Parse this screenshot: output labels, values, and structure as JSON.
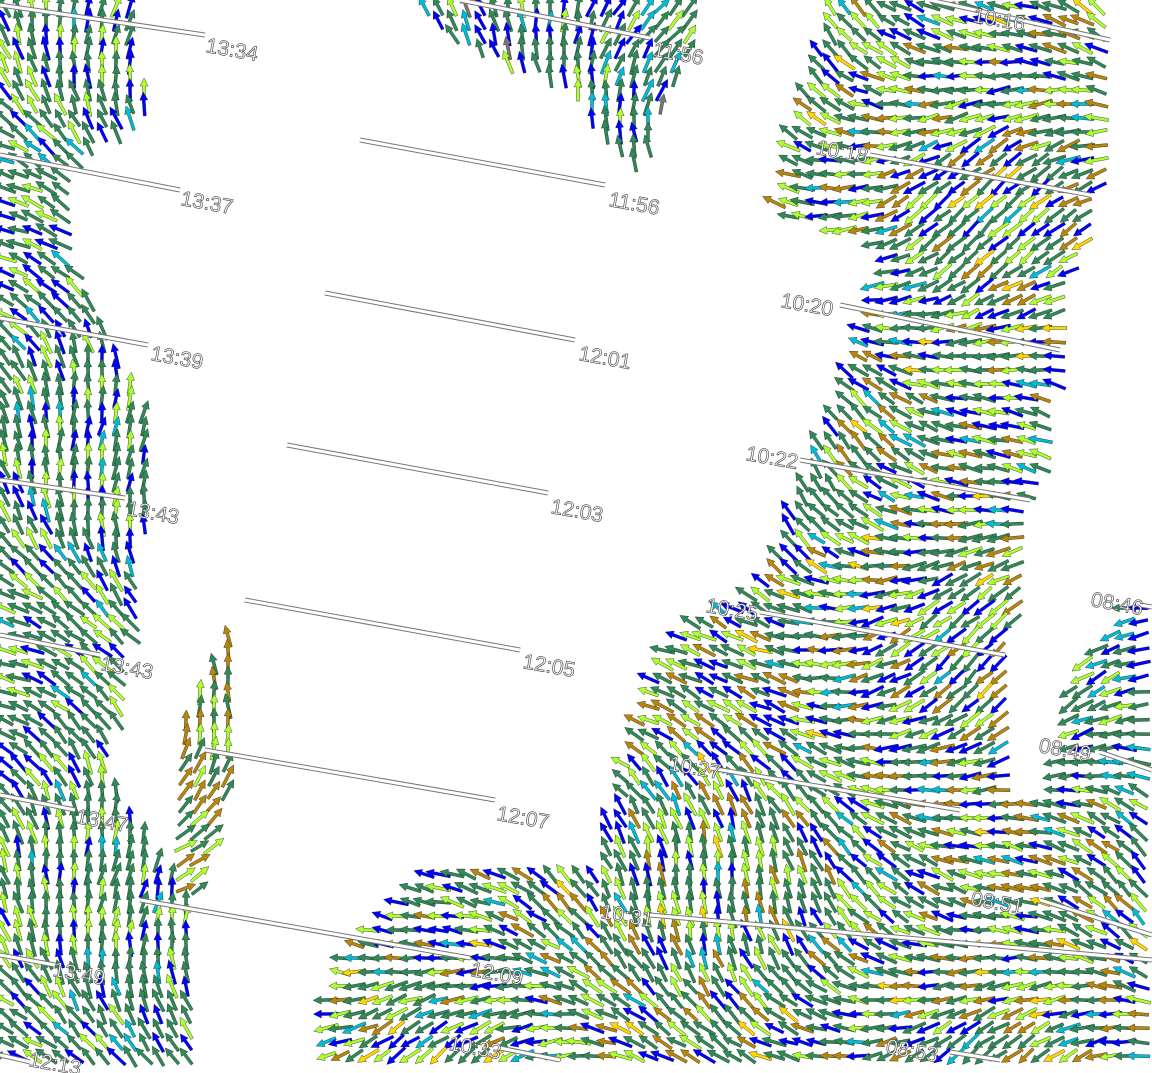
{
  "colors": {
    "dark_green": "#2e8b57",
    "light_green": "#adff2f",
    "blue": "#0000ff",
    "cyan": "#00bcd4",
    "brown": "#b8860b",
    "gold": "#ffd700",
    "orange": "#ff8c00",
    "gray": "#777777"
  },
  "tracks": {
    "left_pass": [
      "13:34",
      "13:37",
      "13:39",
      "13:43",
      "13:43",
      "13:47",
      "13:49",
      "12:13"
    ],
    "middle_pass": [
      "11:56",
      "11:56",
      "12:01",
      "12:03",
      "12:05",
      "12:07",
      "12:09"
    ],
    "right_pass": [
      "10:16",
      "10:18",
      "10:20",
      "10:22",
      "10:25",
      "10:27",
      "10:31",
      "10:33"
    ],
    "far_right_pass": [
      "08:46",
      "08:49",
      "08:51",
      "08:53"
    ]
  }
}
